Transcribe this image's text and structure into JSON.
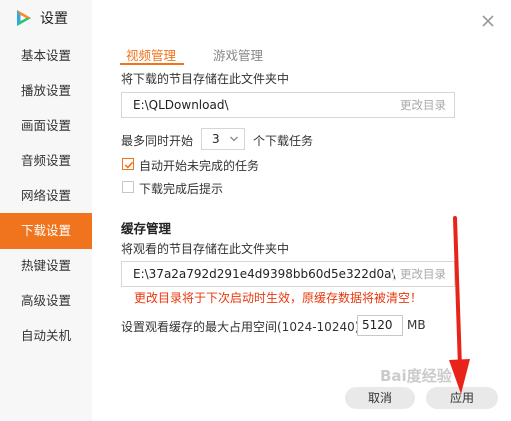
{
  "app": {
    "title": "设置",
    "accent": "#f0741d",
    "warning_color": "#e8380d"
  },
  "sidebar": {
    "items": [
      {
        "label": "基本设置"
      },
      {
        "label": "播放设置"
      },
      {
        "label": "画面设置"
      },
      {
        "label": "音频设置"
      },
      {
        "label": "网络设置"
      },
      {
        "label": "下载设置",
        "active": true
      },
      {
        "label": "热键设置"
      },
      {
        "label": "高级设置"
      },
      {
        "label": "自动关机"
      }
    ]
  },
  "tabs": [
    {
      "label": "视频管理",
      "active": true
    },
    {
      "label": "游戏管理",
      "active": false
    }
  ],
  "download": {
    "dir_label": "将下载的节目存储在此文件夹中",
    "dir_value": "E:\\QLDownload\\",
    "change_dir": "更改目录",
    "max_prefix": "最多同时开始",
    "max_value": "3",
    "max_suffix": "个下载任务",
    "auto_start": {
      "label": "自动开始未完成的任务",
      "checked": true
    },
    "notify_done": {
      "label": "下载完成后提示",
      "checked": false
    }
  },
  "cache": {
    "title": "缓存管理",
    "dir_label": "将观看的节目存储在此文件夹中",
    "dir_value": "E:\\37a2a792d291e4d9398bb60d5e322d0a\\",
    "change_dir": "更改目录",
    "warning": "更改目录将于下次启动时生效，原缓存数据将被清空！",
    "size_label": "设置观看缓存的最大占用空间(1024-10240)",
    "size_value": "5120",
    "size_unit": "MB"
  },
  "footer": {
    "cancel": "取消",
    "apply": "应用"
  },
  "watermark": "Bai度经验",
  "icons": {
    "logo": "tencent-video-logo-icon",
    "close": "close-icon",
    "dropdown": "chevron-down-icon",
    "check": "check-icon"
  }
}
